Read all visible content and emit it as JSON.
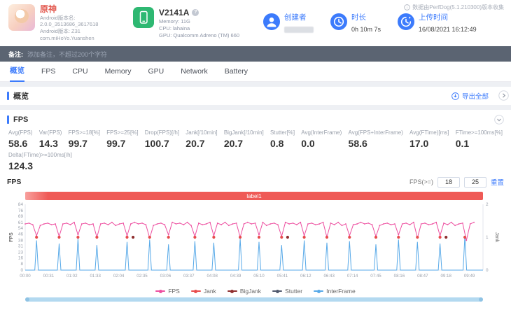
{
  "colors": {
    "accent": "#3c7bfc",
    "app_name": "#e2574d",
    "device_icon": "#2eb872",
    "band": "#ef5a56",
    "note_bar": "#5b6472",
    "scrollbar": "#b3d9f0"
  },
  "header": {
    "app": {
      "name": "原神",
      "line1": "Android版本名:",
      "line2": "2.0.0_3513686_3617618",
      "line3": "Android版本: Z31",
      "line4": "com.miHoYo.Yuanshen"
    },
    "device": {
      "model": "V2141A",
      "memory": "Memory: 11G",
      "cpu": "CPU: lahaina",
      "gpu": "GPU: Qualcomm Adreno (TM) 660"
    },
    "creator": {
      "label": "创建者"
    },
    "duration": {
      "label": "时长",
      "value": "0h 10m 7s"
    },
    "upload": {
      "label": "上传时间",
      "value": "16/08/2021 16:12:49"
    },
    "source_note": "数据由PerfDog(5.1.210300)版本收集"
  },
  "note_bar": {
    "label": "备注:",
    "placeholder": "添加备注，不超过200个字符"
  },
  "tabs": [
    {
      "label": "概览",
      "active": true
    },
    {
      "label": "FPS"
    },
    {
      "label": "CPU"
    },
    {
      "label": "Memory"
    },
    {
      "label": "GPU"
    },
    {
      "label": "Network"
    },
    {
      "label": "Battery"
    }
  ],
  "overview": {
    "title": "概览",
    "export_label": "导出全部"
  },
  "fps_section": {
    "title": "FPS",
    "metrics": [
      {
        "label": "Avg(FPS)",
        "value": "58.6"
      },
      {
        "label": "Var(FPS)",
        "value": "14.3"
      },
      {
        "label": "FPS>=18[%]",
        "value": "99.7"
      },
      {
        "label": "FPS>=25[%]",
        "value": "99.7"
      },
      {
        "label": "Drop(FPS)[/h]",
        "value": "100.7"
      },
      {
        "label": "Jank[/10min]",
        "value": "20.7"
      },
      {
        "label": "BigJank[/10min]",
        "value": "20.7"
      },
      {
        "label": "Stutter[%]",
        "value": "0.8"
      },
      {
        "label": "Avg(InterFrame)",
        "value": "0.0"
      },
      {
        "label": "Avg(FPS+InterFrame)",
        "value": "58.6"
      },
      {
        "label": "Avg(FTime)[ms]",
        "value": "17.0"
      },
      {
        "label": "FTime>=100ms[%]",
        "value": "0.1"
      }
    ],
    "metrics_row2": [
      {
        "label": "Delta(FTime)>=100ms[/h]",
        "value": "124.3"
      }
    ],
    "chart_title": "FPS",
    "threshold_label": "FPS(>=)",
    "threshold1": "18",
    "threshold2": "25",
    "reset_label": "重置",
    "band_label": "label1"
  },
  "chart_data": {
    "type": "line",
    "title": "FPS timeline",
    "x_range_seconds": [
      0,
      607
    ],
    "x_tick_labels": [
      "00:00",
      "00:31",
      "01:02",
      "01:33",
      "02:04",
      "02:35",
      "03:06",
      "03:37",
      "04:08",
      "04:39",
      "05:10",
      "05:41",
      "06:12",
      "06:43",
      "07:14",
      "07:45",
      "08:16",
      "08:47",
      "09:18",
      "09:49"
    ],
    "left_axis": {
      "label": "FPS",
      "max": 84,
      "ticks": [
        84,
        76,
        69,
        61,
        54,
        46,
        38,
        31,
        23,
        16,
        8,
        0
      ]
    },
    "right_axis": {
      "label": "Jank",
      "max": 2,
      "ticks": [
        2,
        1,
        0
      ]
    },
    "legend": [
      {
        "name": "FPS",
        "color": "#ed4fa0"
      },
      {
        "name": "Jank",
        "color": "#e84c4c"
      },
      {
        "name": "BigJank",
        "color": "#8f2f2f"
      },
      {
        "name": "Stutter",
        "color": "#515a6e"
      },
      {
        "name": "InterFrame",
        "color": "#57a9e8"
      }
    ],
    "fps_series": {
      "dt_seconds": 5,
      "values": [
        59,
        60,
        58,
        44,
        57,
        59,
        60,
        58,
        59,
        43,
        59,
        60,
        58,
        61,
        45,
        59,
        60,
        58,
        59,
        42,
        59,
        60,
        58,
        61,
        57,
        59,
        60,
        44,
        59,
        61,
        59,
        60,
        58,
        41,
        57,
        59,
        60,
        58,
        45,
        61,
        59,
        60,
        58,
        61,
        57,
        43,
        60,
        58,
        59,
        61,
        44,
        60,
        58,
        61,
        57,
        59,
        60,
        42,
        59,
        61,
        59,
        60,
        45,
        61,
        57,
        59,
        60,
        58,
        43,
        61,
        59,
        60,
        58,
        61,
        44,
        59,
        60,
        58,
        59,
        61,
        42,
        60,
        58,
        61,
        57,
        59,
        44,
        58,
        59,
        61,
        59,
        60,
        58,
        43,
        57,
        59,
        60,
        58,
        59,
        45,
        59,
        60,
        58,
        61,
        41,
        59,
        60,
        58,
        59,
        61,
        44,
        60,
        58,
        61,
        57,
        59,
        60,
        38,
        59,
        61
      ]
    },
    "jank_events": {
      "value": 1,
      "times": [
        15,
        45,
        70,
        95,
        135,
        165,
        190,
        225,
        250,
        285,
        310,
        340,
        370,
        400,
        430,
        465,
        495,
        520,
        550,
        583
      ]
    },
    "bigjank_events": {
      "value": 1,
      "times": [
        143,
        348,
        558
      ]
    },
    "interframe_spikes": {
      "times": [
        15,
        45,
        70,
        95,
        135,
        165,
        190,
        225,
        250,
        285,
        310,
        340,
        370,
        400,
        430,
        465,
        495,
        520,
        550,
        583
      ],
      "heights": [
        38,
        34,
        40,
        32,
        36,
        39,
        33,
        37,
        35,
        40,
        36,
        32,
        38,
        35,
        37,
        33,
        39,
        36,
        34,
        44
      ]
    }
  }
}
